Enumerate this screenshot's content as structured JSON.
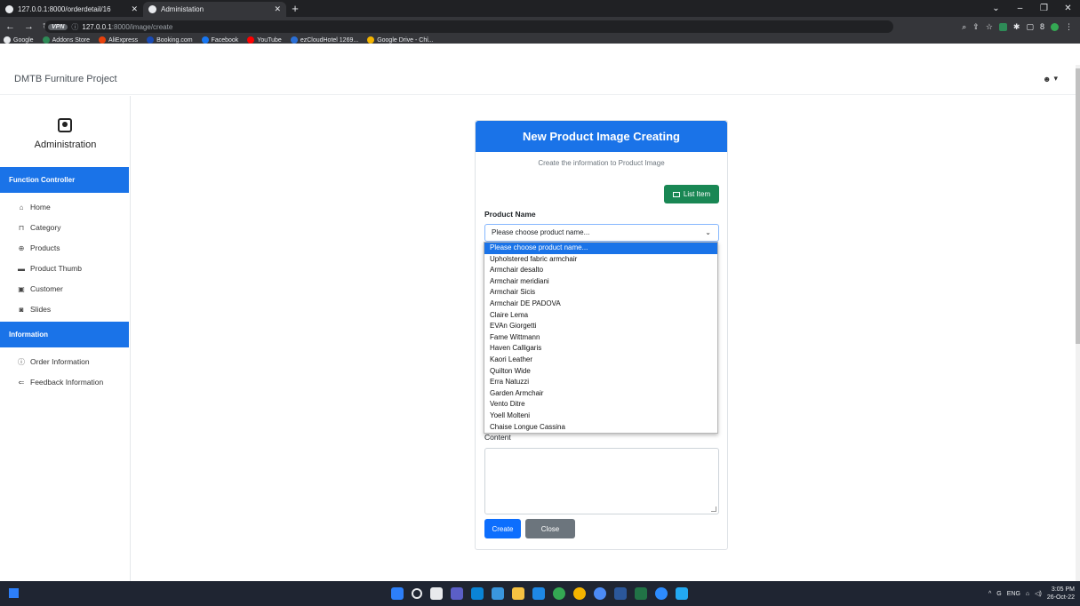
{
  "browser": {
    "tabs": [
      {
        "title": "127.0.0.1:8000/orderdetail/16",
        "active": false
      },
      {
        "title": "Administation",
        "active": true
      }
    ],
    "address": {
      "vpn": "VPN",
      "host": "127.0.0.1",
      "path": ":8000/image/create"
    },
    "bookmarks": [
      {
        "label": "Google",
        "color": "#e8eaed"
      },
      {
        "label": "Addons Store",
        "color": "#2e8b57"
      },
      {
        "label": "AliExpress",
        "color": "#e8410c"
      },
      {
        "label": "Booking.com",
        "color": "#1a4bb4"
      },
      {
        "label": "Facebook",
        "color": "#1877f2"
      },
      {
        "label": "YouTube",
        "color": "#ff0000"
      },
      {
        "label": "ezCloudHotel 1269...",
        "color": "#2b6fd6"
      },
      {
        "label": "Google Drive - Chỉ...",
        "color": "#f4b400"
      }
    ]
  },
  "header": {
    "brand": "DMTB Furniture Project"
  },
  "sidebar": {
    "title": "Administration",
    "sections": [
      {
        "label": "Function Controller"
      },
      {
        "label": "Information"
      }
    ],
    "items": [
      {
        "label": "Home",
        "icon": "⌂"
      },
      {
        "label": "Category",
        "icon": "⊓"
      },
      {
        "label": "Products",
        "icon": "⊕"
      },
      {
        "label": "Product Thumb",
        "icon": "▬"
      },
      {
        "label": "Customer",
        "icon": "▣"
      },
      {
        "label": "Slides",
        "icon": "◙"
      }
    ],
    "info_items": [
      {
        "label": "Order Information",
        "icon": "ⓘ"
      },
      {
        "label": "Feedback Information",
        "icon": "⇐"
      }
    ]
  },
  "form": {
    "title": "New Product Image Creating",
    "subtitle": "Create the information to Product Image",
    "list_button": "List Item",
    "product_label": "Product Name",
    "select_value": "Please choose product name...",
    "content_label": "Content",
    "create_button": "Create",
    "close_button": "Close"
  },
  "dropdown": {
    "options": [
      "Please choose product name...",
      "Upholstered fabric armchair",
      "Armchair desalto",
      "Armchair meridiani",
      "Armchair Sicis",
      "Armchair DE PADOVA",
      "Claire Lema",
      "EVAn Giorgetti",
      "Fame Wittmann",
      "Haven Calligaris",
      "Kaori Leather",
      "Quilton Wide",
      "Erra Natuzzi",
      "Garden Armchair",
      "Vento Ditre",
      "Yoell Molteni",
      "Chaise Longue Cassina"
    ],
    "selected_index": 0
  },
  "taskbar": {
    "lang": "ENG",
    "time": "3:05 PM",
    "date": "26-Oct-22"
  },
  "colors": {
    "primary": "#1a73e8",
    "success": "#198754",
    "secondary": "#6c757d"
  }
}
